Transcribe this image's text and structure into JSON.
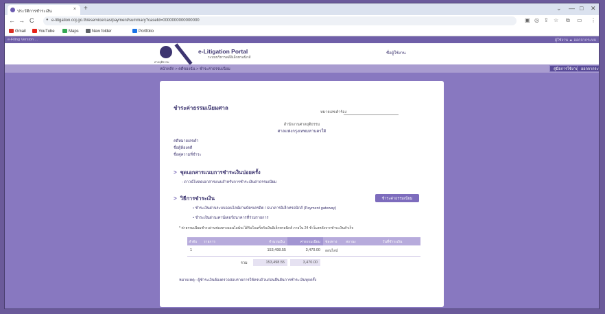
{
  "browser": {
    "tab_title": "ประวัติการชำระเงิน",
    "tab_close": "×",
    "new_tab": "+",
    "window_controls": [
      "⌄",
      "—",
      "□",
      "✕"
    ],
    "nav": [
      "←",
      "→",
      "C"
    ],
    "url": "e-litigation.coj.go.th/eservice/cas/payment/summary?caseId=0000000000000000",
    "bookmarks": [
      "Gmail",
      "YouTube",
      "Maps",
      "New folder",
      "Portfolio"
    ]
  },
  "site": {
    "strip_left": "e-Filing Version ...",
    "strip_right": "ผู้ใช้งาน  ▲ ออกจากระบบ",
    "logo_text": "ศาลยุติธรรม",
    "portal_name": "e-Litigation Portal",
    "portal_sub": "ระบบบริหารคดีอิเล็กทรอนิกส์",
    "user_name": "ชื่อผู้ใช้งาน",
    "breadcrumb": "หน้าหลัก  >  คดีของฉัน  >  ชำระค่าธรรมเนียม",
    "header_buttons": [
      "คู่มือการใช้งาน",
      "ออกจากระบบ"
    ]
  },
  "page": {
    "title": "ชำระค่าธรรมเนียมศาล",
    "ref_label": "หมายเลขคำร้อง",
    "court_line1": "สำนักงานศาลยุติธรรม",
    "court_line2": "ศาลแพ่งกรุงเทพมหานครใต้",
    "meta": [
      "คดีหมายเลขดำ",
      "ชื่อผู้ฟ้องคดี",
      "ชื่อคู่ความที่ชำระ"
    ],
    "section1_title": "ชุดเอกสารแนบการชำระเงินบ่อยครั้ง",
    "section1_note": "- ดาวน์โหลดเอกสารแนบสำหรับการชำระเงินค่าธรรมเนียม",
    "section2_title": "วิธีการชำระเงิน",
    "pay_button": "ชำระค่าธรรมเนียม",
    "options": [
      "• ชำระเงินผ่านระบบออนไลน์ผ่านบัตรเครดิต / ธนาคารอิเล็กทรอนิกส์ (Payment gateway)",
      "• ชำระเงินผ่านเคาน์เตอร์ธนาคารที่ร่วมรายการ"
    ],
    "remark": "* ค่าธรรมเนียมชำระผ่านช่องทางออนไลน์จะได้รับใบเสร็จรับเงินอิเล็กทรอนิกส์ ภายใน 24 ชั่วโมงหลังจากชำระเงินสำเร็จ",
    "table": {
      "headers": [
        "ลำดับ",
        "รายการ",
        "จำนวนเงิน",
        "ค่าธรรมเนียม",
        "ช่องทาง",
        "สถานะ",
        "วันที่ชำระเงิน"
      ],
      "rows": [
        {
          "no": "1",
          "amount": "153,498.55",
          "fee": "3,470.00",
          "channel": "ออนไลน์"
        }
      ],
      "total_label": "รวม",
      "total_amount": "153,498.55",
      "total_fee": "3,470.00"
    },
    "footnote": "หมายเหตุ : ผู้ชำระเงินต้องตรวจสอบรายการให้ครบถ้วนก่อนยืนยันการชำระเงินทุกครั้ง"
  }
}
